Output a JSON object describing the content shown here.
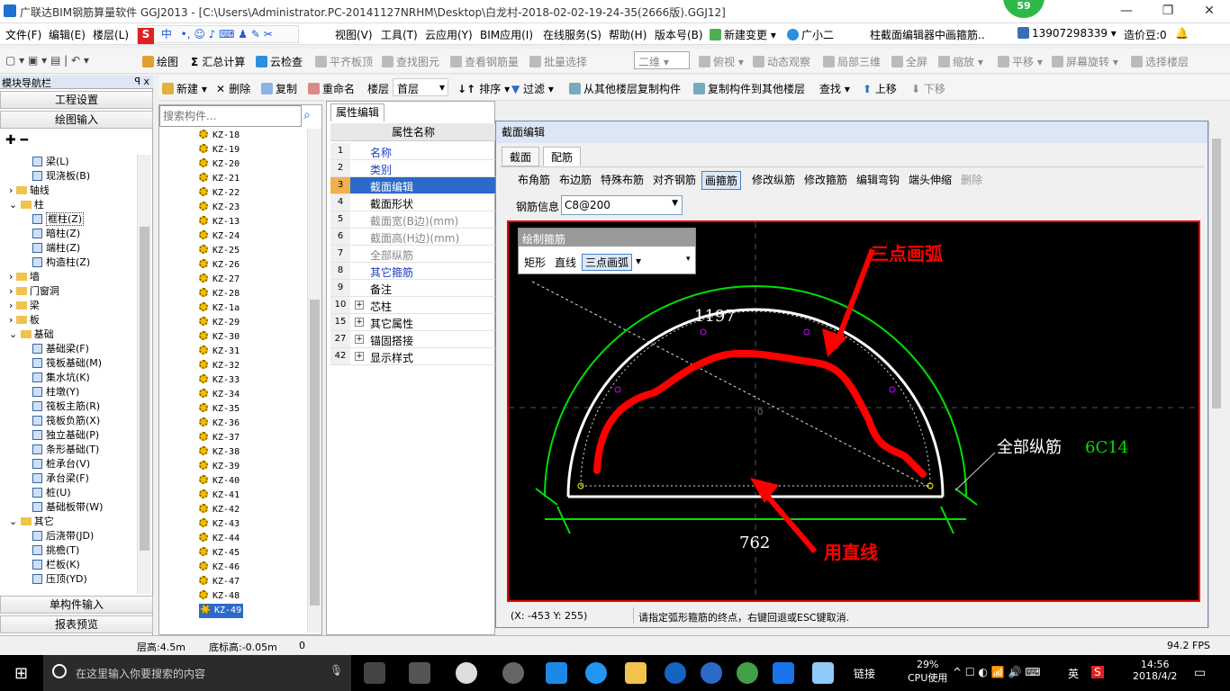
{
  "window": {
    "title": "广联达BIM钢筋算量软件 GGJ2013 - [C:\\Users\\Administrator.PC-20141127NRHM\\Desktop\\白龙村-2018-02-02-19-24-35(2666版).GGJ12]",
    "badge": "59"
  },
  "menu": {
    "items": [
      "文件(F)",
      "编辑(E)",
      "楼层(L)",
      "视图(V)",
      "工具(T)",
      "云应用(Y)",
      "BIM应用(I)",
      "在线服务(S)",
      "帮助(H)",
      "版本号(B)",
      "新建变更",
      "广小二",
      "柱截面编辑器中画箍筋..",
      "13907298339",
      "造价豆:0"
    ],
    "ime": "中"
  },
  "toolbar1": {
    "items": [
      "绘图",
      "汇总计算",
      "云检查",
      "平齐板顶",
      "查找图元",
      "查看钢筋量",
      "批量选择",
      "二维",
      "俯视",
      "动态观察",
      "局部三维",
      "全屏",
      "缩放",
      "平移",
      "屏幕旋转",
      "选择楼层"
    ]
  },
  "toolbar2": {
    "items": [
      "新建",
      "删除",
      "复制",
      "重命名",
      "楼层",
      "首层",
      "排序",
      "过滤",
      "从其他楼层复制构件",
      "复制构件到其他楼层",
      "查找",
      "上移",
      "下移"
    ]
  },
  "nav": {
    "header": "模块导航栏",
    "pin": "ꟼ x",
    "buttons": [
      "工程设置",
      "绘图输入"
    ],
    "bottom_buttons": [
      "单构件输入",
      "报表预览"
    ],
    "tree": [
      {
        "label": "梁(L)",
        "indent": 2,
        "type": "comp"
      },
      {
        "label": "现浇板(B)",
        "indent": 2,
        "type": "comp"
      },
      {
        "label": "轴线",
        "indent": 0,
        "type": "folder",
        "expander": "›"
      },
      {
        "label": "柱",
        "indent": 0,
        "type": "folder",
        "expander": "⌄"
      },
      {
        "label": "框柱(Z)",
        "indent": 2,
        "type": "comp",
        "selected": true
      },
      {
        "label": "暗柱(Z)",
        "indent": 2,
        "type": "comp"
      },
      {
        "label": "端柱(Z)",
        "indent": 2,
        "type": "comp"
      },
      {
        "label": "构造柱(Z)",
        "indent": 2,
        "type": "comp"
      },
      {
        "label": "墙",
        "indent": 0,
        "type": "folder",
        "expander": "›"
      },
      {
        "label": "门窗洞",
        "indent": 0,
        "type": "folder",
        "expander": "›"
      },
      {
        "label": "梁",
        "indent": 0,
        "type": "folder",
        "expander": "›"
      },
      {
        "label": "板",
        "indent": 0,
        "type": "folder",
        "expander": "›"
      },
      {
        "label": "基础",
        "indent": 0,
        "type": "folder",
        "expander": "⌄"
      },
      {
        "label": "基础梁(F)",
        "indent": 2,
        "type": "comp"
      },
      {
        "label": "筏板基础(M)",
        "indent": 2,
        "type": "comp"
      },
      {
        "label": "集水坑(K)",
        "indent": 2,
        "type": "comp"
      },
      {
        "label": "柱墩(Y)",
        "indent": 2,
        "type": "comp"
      },
      {
        "label": "筏板主筋(R)",
        "indent": 2,
        "type": "comp"
      },
      {
        "label": "筏板负筋(X)",
        "indent": 2,
        "type": "comp"
      },
      {
        "label": "独立基础(P)",
        "indent": 2,
        "type": "comp"
      },
      {
        "label": "条形基础(T)",
        "indent": 2,
        "type": "comp"
      },
      {
        "label": "桩承台(V)",
        "indent": 2,
        "type": "comp"
      },
      {
        "label": "承台梁(F)",
        "indent": 2,
        "type": "comp"
      },
      {
        "label": "桩(U)",
        "indent": 2,
        "type": "comp"
      },
      {
        "label": "基础板带(W)",
        "indent": 2,
        "type": "comp"
      },
      {
        "label": "其它",
        "indent": 0,
        "type": "folder",
        "expander": "⌄"
      },
      {
        "label": "后浇带(JD)",
        "indent": 2,
        "type": "comp"
      },
      {
        "label": "挑檐(T)",
        "indent": 2,
        "type": "comp"
      },
      {
        "label": "栏板(K)",
        "indent": 2,
        "type": "comp"
      },
      {
        "label": "压顶(YD)",
        "indent": 2,
        "type": "comp"
      }
    ]
  },
  "components": {
    "search_placeholder": "搜索构件...",
    "items": [
      "KZ-18",
      "KZ-19",
      "KZ-20",
      "KZ-21",
      "KZ-22",
      "KZ-23",
      "KZ-13",
      "KZ-24",
      "KZ-25",
      "KZ-26",
      "KZ-27",
      "KZ-28",
      "KZ-1a",
      "KZ-29",
      "KZ-30",
      "KZ-31",
      "KZ-32",
      "KZ-33",
      "KZ-34",
      "KZ-35",
      "KZ-36",
      "KZ-37",
      "KZ-38",
      "KZ-39",
      "KZ-40",
      "KZ-41",
      "KZ-42",
      "KZ-43",
      "KZ-44",
      "KZ-45",
      "KZ-46",
      "KZ-47",
      "KZ-48",
      "KZ-49"
    ],
    "selected": "KZ-49"
  },
  "properties": {
    "tab": "属性编辑",
    "header": "属性名称",
    "rows": [
      {
        "num": "1",
        "label": "名称",
        "color": "#1f3fbf"
      },
      {
        "num": "2",
        "label": "类别",
        "color": "#1f3fbf"
      },
      {
        "num": "3",
        "label": "截面编辑",
        "color": "#fff",
        "selected": true
      },
      {
        "num": "4",
        "label": "截面形状",
        "color": "#000"
      },
      {
        "num": "5",
        "label": "截面宽(B边)(mm)",
        "color": "#888"
      },
      {
        "num": "6",
        "label": "截面高(H边)(mm)",
        "color": "#888"
      },
      {
        "num": "7",
        "label": "全部纵筋",
        "color": "#888"
      },
      {
        "num": "8",
        "label": "其它箍筋",
        "color": "#1f3fbf"
      },
      {
        "num": "9",
        "label": "备注",
        "color": "#000"
      },
      {
        "num": "10",
        "label": "芯柱",
        "color": "#000",
        "expand": true
      },
      {
        "num": "15",
        "label": "其它属性",
        "color": "#000",
        "expand": true
      },
      {
        "num": "27",
        "label": "锚固搭接",
        "color": "#000",
        "expand": true
      },
      {
        "num": "42",
        "label": "显示样式",
        "color": "#000",
        "expand": true
      }
    ]
  },
  "dialog": {
    "title": "截面编辑",
    "tabs": [
      "截面",
      "配筋"
    ],
    "active_tab": "配筋",
    "tools": [
      "布角筋",
      "布边筋",
      "特殊布筋",
      "对齐钢筋",
      "画箍筋",
      "修改纵筋",
      "修改箍筋",
      "编辑弯钩",
      "端头伸缩",
      "删除"
    ],
    "active_tool": "画箍筋",
    "rebar_label": "钢筋信息",
    "rebar_value": "C8@200",
    "draw_box": {
      "title": "绘制箍筋",
      "buttons": [
        "矩形",
        "直线",
        "三点画弧"
      ],
      "active": "三点画弧"
    },
    "canvas": {
      "dim_top": "1197",
      "dim_bottom": "762",
      "rebar_text": "全部纵筋",
      "rebar_spec": "6C14",
      "note_arc": "三点画弧",
      "note_line": "用直线",
      "origin": "0"
    },
    "coords": "(X: -453 Y: 255)",
    "status": "请指定弧形箍筋的终点，右键回退或ESC键取消."
  },
  "statusbar": {
    "floor_height": "层高:4.5m",
    "base_height": "底标高:-0.05m",
    "value": "0",
    "fps": "94.2 FPS"
  },
  "taskbar": {
    "search": "在这里输入你要搜索的内容",
    "link": "链接",
    "cpu": "29%",
    "cpu_label": "CPU使用",
    "lang": "英",
    "time": "14:56",
    "date": "2018/4/2"
  },
  "colors": {
    "accent": "#2b6ac9",
    "canvas_bg": "#000000",
    "arc_green": "#00e000",
    "annotation_red": "#ff0000"
  }
}
